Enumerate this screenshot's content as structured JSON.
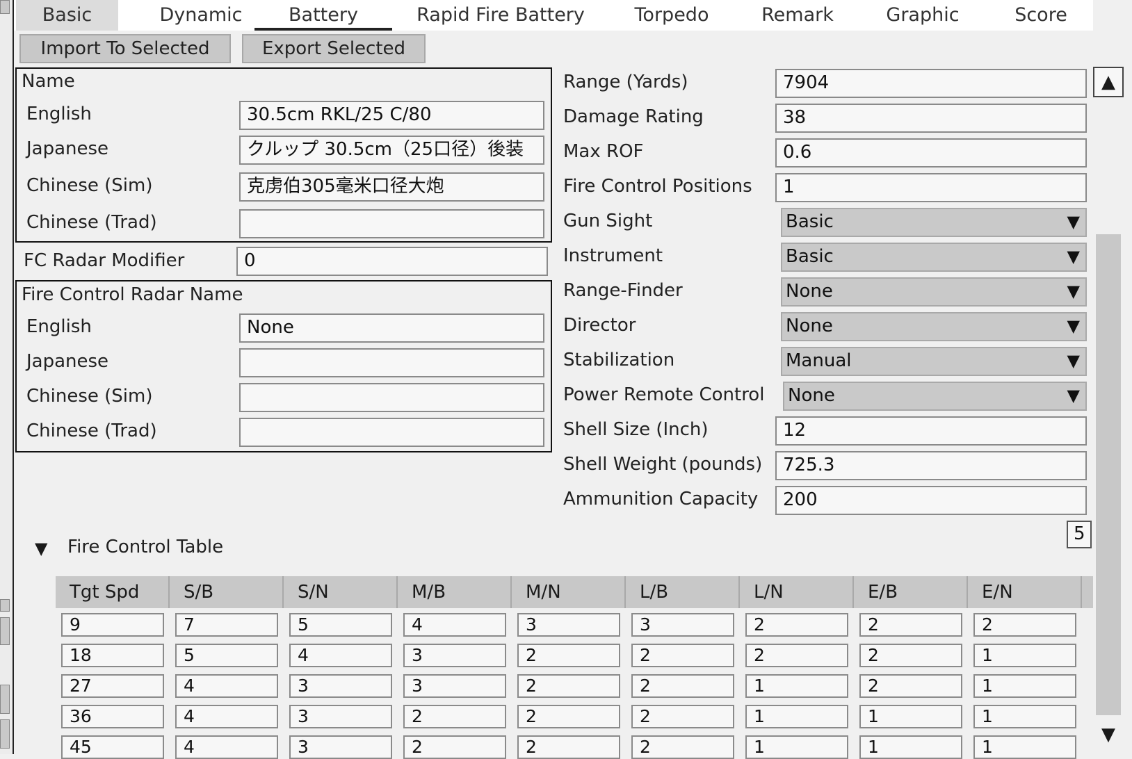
{
  "tabs": [
    "Basic",
    "Dynamic",
    "Battery",
    "Rapid Fire Battery",
    "Torpedo",
    "Remark",
    "Graphic",
    "Score"
  ],
  "actions": {
    "import_label": "Import To Selected",
    "export_label": "Export Selected"
  },
  "name_group": {
    "title": "Name",
    "rows": [
      {
        "label": "English",
        "value": "30.5cm RKL/25 C/80"
      },
      {
        "label": "Japanese",
        "value": "クルップ 30.5cm（25口径）後装"
      },
      {
        "label": "Chinese (Sim)",
        "value": "克虏伯305毫米口径大炮"
      },
      {
        "label": "Chinese (Trad)",
        "value": ""
      }
    ]
  },
  "fc_radar_modifier": {
    "label": "FC Radar Modifier",
    "value": "0"
  },
  "fc_radar_name_group": {
    "title": "Fire Control Radar Name",
    "rows": [
      {
        "label": "English",
        "value": "None"
      },
      {
        "label": "Japanese",
        "value": ""
      },
      {
        "label": "Chinese (Sim)",
        "value": ""
      },
      {
        "label": "Chinese (Trad)",
        "value": ""
      }
    ]
  },
  "right_fields": [
    {
      "label": "Range (Yards)",
      "value": "7904",
      "kind": "input"
    },
    {
      "label": "Damage Rating",
      "value": "38",
      "kind": "input"
    },
    {
      "label": "Max ROF",
      "value": "0.6",
      "kind": "input"
    },
    {
      "label": "Fire Control Positions",
      "value": "1",
      "kind": "input"
    },
    {
      "label": "Gun Sight",
      "value": "Basic",
      "kind": "select"
    },
    {
      "label": "Instrument",
      "value": "Basic",
      "kind": "select"
    },
    {
      "label": "Range-Finder",
      "value": "None",
      "kind": "select"
    },
    {
      "label": "Director",
      "value": "None",
      "kind": "select"
    },
    {
      "label": "Stabilization",
      "value": "Manual",
      "kind": "select"
    },
    {
      "label": "Power Remote Control",
      "value": "None",
      "kind": "select"
    },
    {
      "label": "Shell Size (Inch)",
      "value": "12",
      "kind": "input"
    },
    {
      "label": "Shell Weight (pounds)",
      "value": "725.3",
      "kind": "input"
    },
    {
      "label": "Ammunition Capacity",
      "value": "200",
      "kind": "input"
    }
  ],
  "fire_control_table": {
    "title": "Fire Control Table",
    "count": "5",
    "columns": [
      "Tgt Spd",
      "S/B",
      "S/N",
      "M/B",
      "M/N",
      "L/B",
      "L/N",
      "E/B",
      "E/N"
    ],
    "rows": [
      [
        "9",
        "7",
        "5",
        "4",
        "3",
        "3",
        "2",
        "2",
        "2"
      ],
      [
        "18",
        "5",
        "4",
        "3",
        "2",
        "2",
        "2",
        "2",
        "1"
      ],
      [
        "27",
        "4",
        "3",
        "3",
        "2",
        "2",
        "1",
        "2",
        "1"
      ],
      [
        "36",
        "4",
        "3",
        "2",
        "2",
        "2",
        "1",
        "1",
        "1"
      ],
      [
        "45",
        "4",
        "3",
        "2",
        "2",
        "2",
        "1",
        "1",
        "1"
      ]
    ]
  },
  "icons": {
    "scroll_up": "▲",
    "scroll_down": "▼",
    "dropdown": "▼",
    "collapse": "▼"
  }
}
